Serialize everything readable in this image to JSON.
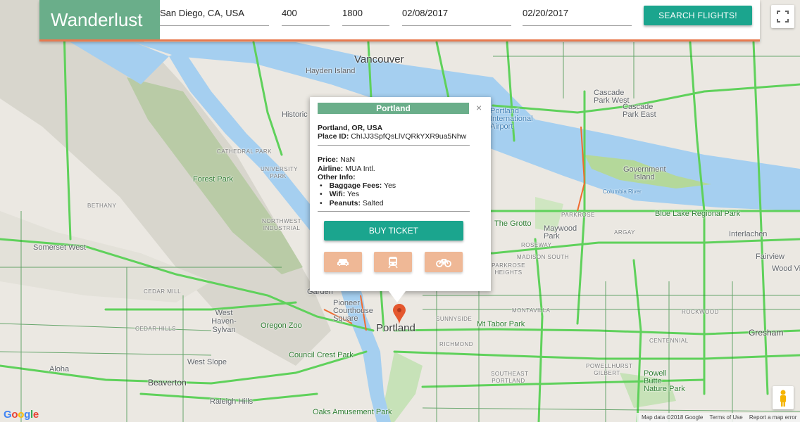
{
  "header": {
    "brand": "Wanderlust",
    "origin": "San Diego, CA, USA",
    "budget": "400",
    "time": "1800",
    "depart_date": "02/08/2017",
    "return_date": "02/20/2017",
    "search_label": "SEARCH FLIGHTS!"
  },
  "info_window": {
    "title": "Portland",
    "location": "Portland, OR, USA",
    "place_id_label": "Place ID:",
    "place_id": "ChIJJ3SpfQsLlVQRkYXR9ua5Nhw",
    "price_label": "Price:",
    "price": "NaN",
    "airline_label": "Airline:",
    "airline": "MUA Intl.",
    "other_info_label": "Other Info:",
    "baggage_label": "Baggage Fees:",
    "baggage": "Yes",
    "wifi_label": "Wifi:",
    "wifi": "Yes",
    "peanuts_label": "Peanuts:",
    "peanuts": "Salted",
    "buy_label": "BUY TICKET",
    "close_glyph": "×",
    "transport_icons": [
      "car-icon",
      "train-icon",
      "bicycle-icon"
    ]
  },
  "map": {
    "labels": {
      "vancouver": "Vancouver",
      "hayden_island": "Hayden Island",
      "portland": "Portland",
      "portland_airport": "Portland International Airport",
      "cascade_park": "Cascade Park West",
      "cascade_park_east": "Cascade Park East",
      "government_island": "Government Island",
      "columbia_river": "Columbia River",
      "blue_lake": "Blue Lake Regional Park",
      "parkrose": "PARKROSE",
      "the_grotto": "The Grotto",
      "maywood_park": "Maywood Park",
      "argay": "ARGAY",
      "interlachen": "Interlachen",
      "roseway": "ROSEWAY",
      "madison_south": "MADISON SOUTH",
      "fairview": "Fairview",
      "wood_village": "Wood Vi",
      "forest_park": "Forest Park",
      "bethany": "BETHANY",
      "somerset_west": "Somerset West",
      "cedar_mill": "CEDAR MILL",
      "west_haven": "West Haven-Sylvan",
      "cedar_hills": "CEDAR HILLS",
      "oregon_zoo": "Oregon Zoo",
      "west_slope": "West Slope",
      "aloha": "Aloha",
      "beaverton": "Beaverton",
      "raleigh_hills": "Raleigh Hills",
      "council_crest": "Council Crest Park",
      "oaks_park": "Oaks Amusement Park",
      "sunnyside": "SUNNYSIDE",
      "mt_tabor": "Mt Tabor Park",
      "richmond": "RICHMOND",
      "montavilla": "MONTAVILLA",
      "rockwood": "ROCKWOOD",
      "gresham": "Gresham",
      "centennial": "CENTENNIAL",
      "powellhurst": "POWELLHURST GILBERT",
      "powell_butte": "Powell Butte Nature Park",
      "southeast_portland": "SOUTHEAST PORTLAND",
      "pioneer_square": "Pioneer Courthouse Square",
      "garden": "Garden",
      "historic": "Historic",
      "cathedral_park": "CATHEDRAL PARK",
      "university_park": "UNIVERSITY PARK",
      "northwest_industrial": "NORTHWEST INDUSTRIAL",
      "parkrose_heights": "PARKROSE HEIGHTS"
    },
    "attribution": "Map data ©2018 Google",
    "terms": "Terms of Use",
    "report": "Report a map error",
    "google": "Google"
  },
  "colors": {
    "brand_green": "#6aae8a",
    "accent_teal": "#1ba58e",
    "accent_orange": "#e8794f",
    "mode_button": "#efb896",
    "river": "#a5cff0",
    "traffic_green": "#5fd15b"
  }
}
